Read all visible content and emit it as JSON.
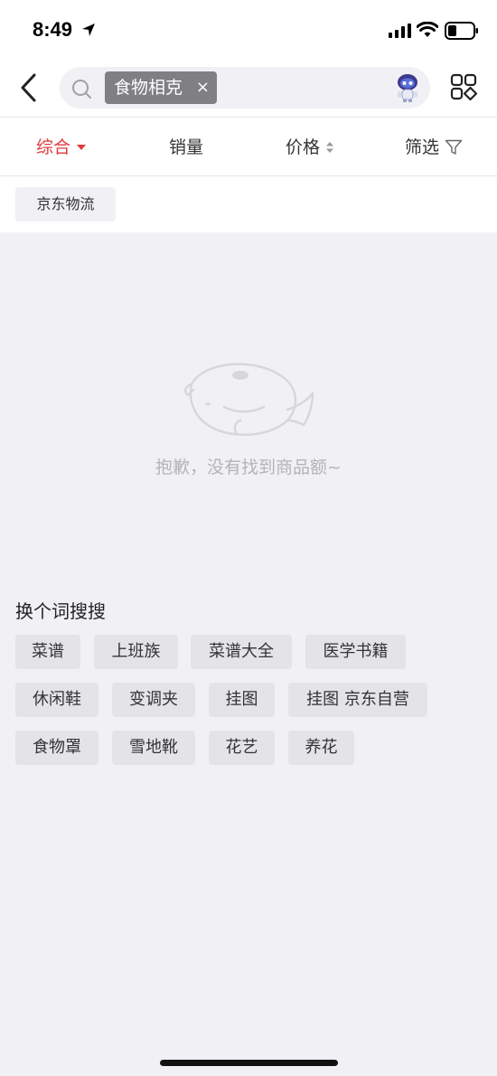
{
  "status_bar": {
    "time": "8:49"
  },
  "search": {
    "keyword": "食物相克",
    "chip_close": "×"
  },
  "sort_tabs": {
    "composite": "综合",
    "sales": "销量",
    "price": "价格",
    "filter": "筛选"
  },
  "filter_chips": {
    "jd_logistics": "京东物流"
  },
  "empty_state": {
    "message": "抱歉，没有找到商品额~"
  },
  "suggestions": {
    "title": "换个词搜搜",
    "tags": [
      "菜谱",
      "上班族",
      "菜谱大全",
      "医学书籍",
      "休闲鞋",
      "变调夹",
      "挂图",
      "挂图 京东自营",
      "食物罩",
      "雪地靴",
      "花艺",
      "养花"
    ]
  },
  "colors": {
    "accent_red": "#e0393e",
    "background": "#f1f1f5",
    "chip_gray": "#7f7f84"
  }
}
